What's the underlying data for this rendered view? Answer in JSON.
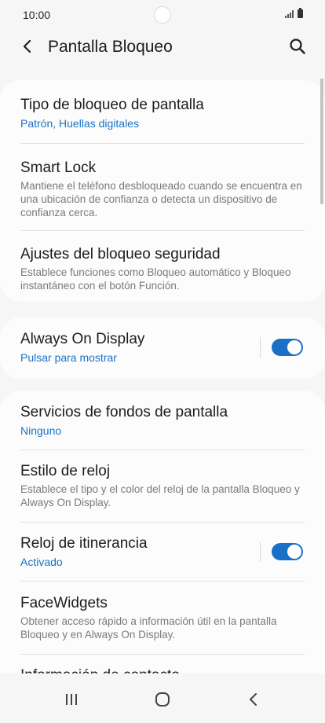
{
  "status_bar": {
    "time": "10:00"
  },
  "header": {
    "title": "Pantalla Bloqueo"
  },
  "sections": [
    {
      "items": [
        {
          "title": "Tipo de bloqueo de pantalla",
          "subtitle": "Patrón, Huellas digitales"
        },
        {
          "title": "Smart Lock",
          "description": "Mantiene el teléfono desbloqueado cuando se encuentra en una ubicación de confianza o detecta un dispositivo de confianza cerca."
        },
        {
          "title": "Ajustes del bloqueo seguridad",
          "description": "Establece funciones como Bloqueo automático y Bloqueo instantáneo con el botón Función."
        }
      ]
    },
    {
      "items": [
        {
          "title": "Always On Display",
          "subtitle": "Pulsar para mostrar",
          "toggle": true
        }
      ]
    },
    {
      "items": [
        {
          "title": "Servicios de fondos de pantalla",
          "subtitle": "Ninguno"
        },
        {
          "title": "Estilo de reloj",
          "description": "Establece el tipo y el color del reloj de la pantalla Bloqueo y Always On Display."
        },
        {
          "title": "Reloj de itinerancia",
          "subtitle": "Activado",
          "toggle": true
        },
        {
          "title": "FaceWidgets",
          "description": "Obtener acceso rápido a información útil en la pantalla Bloqueo y en Always On Display."
        },
        {
          "title": "Información de contacto"
        }
      ]
    }
  ],
  "icons": {
    "back": "chevron-left-icon",
    "search": "search-icon",
    "recents": "recent-apps-icon",
    "home": "home-icon",
    "nav_back": "nav-back-icon"
  },
  "colors": {
    "accent": "#1a6fc6",
    "link_text": "#1873c7",
    "background": "#f6f6f6",
    "card": "#fcfcfc"
  }
}
